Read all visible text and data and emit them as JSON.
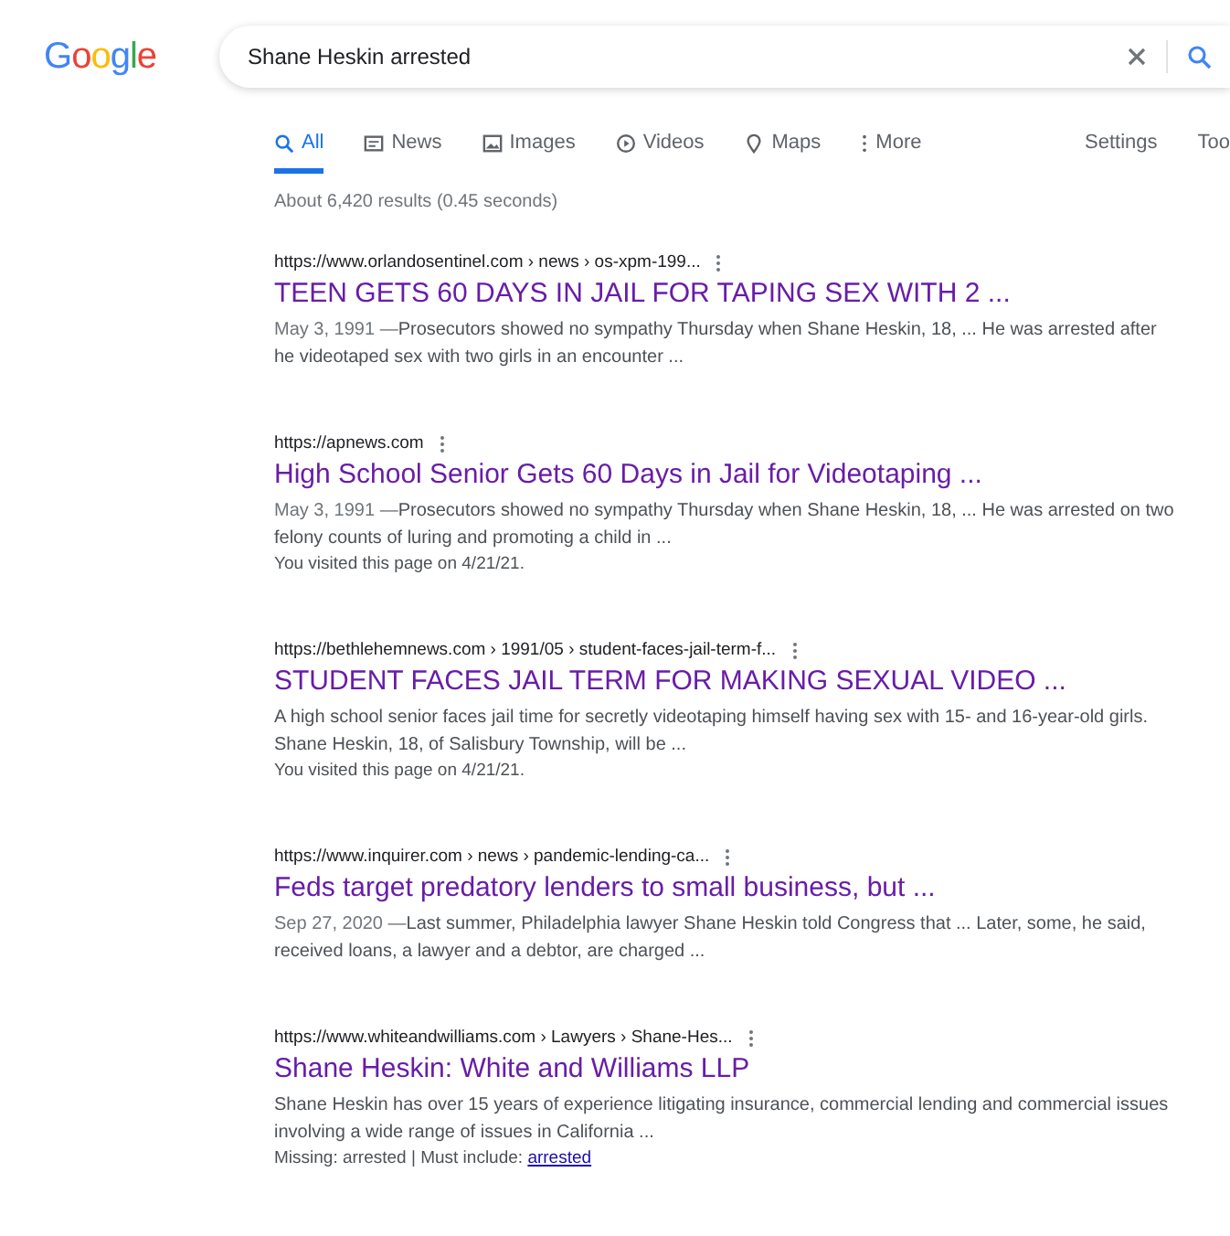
{
  "logo": "Google",
  "search": {
    "value": "Shane Heskin arrested"
  },
  "tabs": [
    {
      "label": "All",
      "kind": "search",
      "selected": true
    },
    {
      "label": "News",
      "kind": "news",
      "selected": false
    },
    {
      "label": "Images",
      "kind": "images",
      "selected": false
    },
    {
      "label": "Videos",
      "kind": "video",
      "selected": false
    },
    {
      "label": "Maps",
      "kind": "maps",
      "selected": false
    },
    {
      "label": "More",
      "kind": "more",
      "selected": false
    }
  ],
  "tools": [
    "Settings",
    "Too"
  ],
  "result_stats": "About 6,420 results (0.45 seconds)",
  "results": [
    {
      "url": "https://www.orlandosentinel.com › news › os-xpm-199...",
      "title": "TEEN GETS 60 DAYS IN JAIL FOR TAPING SEX WITH 2 ...",
      "date": "May 3, 1991 —",
      "snippet": "Prosecutors showed no sympathy Thursday when Shane Heskin, 18, ... He was arrested after he videotaped sex with two girls in an encounter ..."
    },
    {
      "url": "https://apnews.com",
      "title": "High School Senior Gets 60 Days in Jail for Videotaping ...",
      "date": "May 3, 1991 —",
      "snippet": "Prosecutors showed no sympathy Thursday when Shane Heskin, 18, ... He was arrested on two felony counts of luring and promoting a child in ...",
      "visited": "You visited this page on 4/21/21."
    },
    {
      "url": "https://bethlehemnews.com › 1991/05 › student-faces-jail-term-f...",
      "title": "STUDENT FACES JAIL TERM FOR MAKING SEXUAL VIDEO ...",
      "snippet": "A high school senior faces jail time for secretly videotaping himself having sex with 15- and 16-year-old girls. Shane Heskin, 18, of Salisbury Township, will be ...",
      "visited": "You visited this page on 4/21/21."
    },
    {
      "url": "https://www.inquirer.com › news › pandemic-lending-ca...",
      "title": "Feds target predatory lenders to small business, but ...",
      "date": "Sep 27, 2020 —",
      "snippet": "Last summer, Philadelphia lawyer Shane Heskin told Congress that ... Later, some, he said, received loans, a lawyer and a debtor, are charged ..."
    },
    {
      "url": "https://www.whiteandwilliams.com › Lawyers › Shane-Hes...",
      "title": "Shane Heskin: White and Williams LLP",
      "snippet": "Shane Heskin has over 15 years of experience litigating insurance, commercial lending and commercial issues involving a wide range of issues in California ...",
      "missing": "Missing: arrested | Must include:",
      "missing_link": "arrested"
    }
  ]
}
